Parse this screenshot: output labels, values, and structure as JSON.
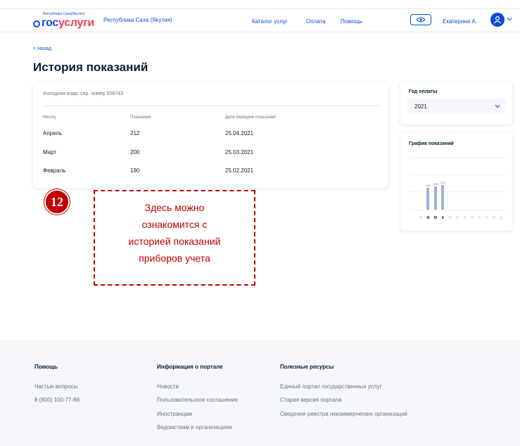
{
  "header": {
    "logo_small": "Республика Саха(Якутия)",
    "logo_part1": "гос",
    "logo_part2": "услуги",
    "region": "Республика Саха (Якутия)",
    "nav": [
      "Каталог услуг",
      "Оплата",
      "Помощь"
    ],
    "user_name": "Екатерина А."
  },
  "page": {
    "back_label": "< Назад",
    "title": "История показаний"
  },
  "readings": {
    "meter_label": "Холодная вода, сер. номер 558743",
    "columns": [
      "Месяц",
      "Показания",
      "Дата передачи показаний"
    ],
    "rows": [
      {
        "month": "Апрель",
        "value": "212",
        "date": "25.04.2021"
      },
      {
        "month": "Март",
        "value": "200",
        "date": "25.03.2021"
      },
      {
        "month": "Февраль",
        "value": "190",
        "date": "25.02.2021"
      }
    ]
  },
  "year_filter": {
    "label": "Год оплаты",
    "value": "2021"
  },
  "chart_data": {
    "type": "bar",
    "title": "График показаний",
    "categories": [
      "Я",
      "Ф",
      "М",
      "А",
      "М",
      "И",
      "И",
      "А",
      "С",
      "О",
      "Н",
      "Д"
    ],
    "values": [
      null,
      190,
      200,
      212,
      null,
      null,
      null,
      null,
      null,
      null,
      null,
      null
    ],
    "data_labels": [
      "",
      "190",
      "200",
      "212",
      "",
      "",
      "",
      "",
      "",
      "",
      "",
      ""
    ],
    "highlighted_categories": [
      1,
      2,
      3
    ],
    "ylim": [
      0,
      450
    ],
    "grid": true
  },
  "annotation": {
    "badge": "12",
    "lines": [
      "Здесь можно",
      "ознакомится с",
      "историей показаний",
      "приборов учета"
    ]
  },
  "footer": {
    "col1": {
      "heading": "Помощь",
      "links": [
        "Частые вопросы",
        "8 (800) 100-77-88"
      ]
    },
    "col2": {
      "heading": "Информация о портале",
      "links": [
        "Новости",
        "Пользовательское соглашение",
        "Иностранцам",
        "Ведомствам и организациям"
      ]
    },
    "col3": {
      "heading": "Полезные ресурсы",
      "links": [
        "Единый портал государственных услуг",
        "Старая версия портала",
        "Сведения реестра некоммерческих организаций"
      ]
    }
  },
  "colors": {
    "brand_blue": "#0d4cd3",
    "brand_red": "#ee3f58",
    "annotation_red": "#c00000",
    "bar_color": "#9fb0d9"
  }
}
